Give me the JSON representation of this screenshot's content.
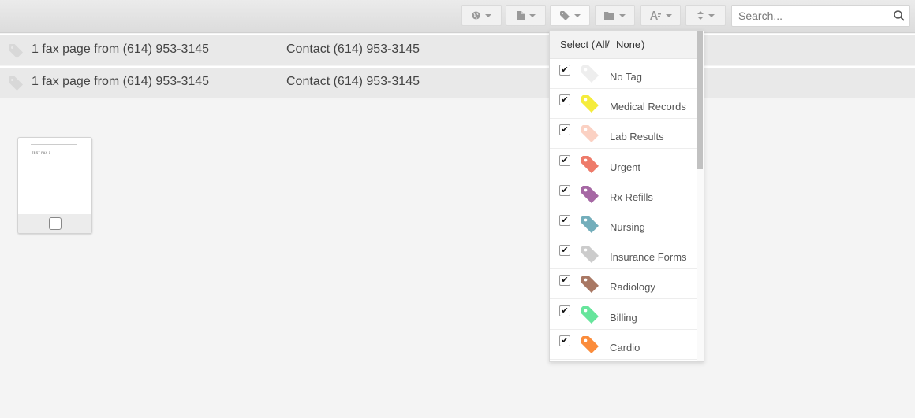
{
  "toolbar": {
    "buttons": [
      {
        "icon": "globe-icon"
      },
      {
        "icon": "document-icon"
      },
      {
        "icon": "tag-icon"
      },
      {
        "icon": "folder-icon"
      },
      {
        "icon": "font-icon"
      },
      {
        "icon": "sort-icon"
      }
    ],
    "search": {
      "placeholder": "Search...",
      "value": ""
    }
  },
  "fax_rows": [
    {
      "title": "1 fax page from (614) 953-3145",
      "contact": "Contact (614) 953-3145"
    },
    {
      "title": "1 fax page from (614) 953-3145",
      "contact": "Contact (614) 953-3145"
    }
  ],
  "thumbnail": {
    "page_text": "TEST FAX 1"
  },
  "tag_dropdown": {
    "select_label": "Select ( ",
    "all_label": "All",
    "separator": " / ",
    "none_label": "None",
    "close_paren": " )",
    "check_mark": "✔",
    "items": [
      {
        "label": "No Tag",
        "color": "#eeeeee",
        "checked": true
      },
      {
        "label": "Medical Records",
        "color": "#f5ec3c",
        "checked": true
      },
      {
        "label": "Lab Results",
        "color": "#fbd1c3",
        "checked": true
      },
      {
        "label": "Urgent",
        "color": "#ee7b6a",
        "checked": true
      },
      {
        "label": "Rx Refills",
        "color": "#a668a4",
        "checked": true
      },
      {
        "label": "Nursing",
        "color": "#73aebb",
        "checked": true
      },
      {
        "label": "Insurance Forms",
        "color": "#cccccc",
        "checked": true
      },
      {
        "label": "Radiology",
        "color": "#a97864",
        "checked": true
      },
      {
        "label": "Billing",
        "color": "#67e59c",
        "checked": true
      },
      {
        "label": "Cardio",
        "color": "#fb8c3b",
        "checked": true
      }
    ]
  }
}
